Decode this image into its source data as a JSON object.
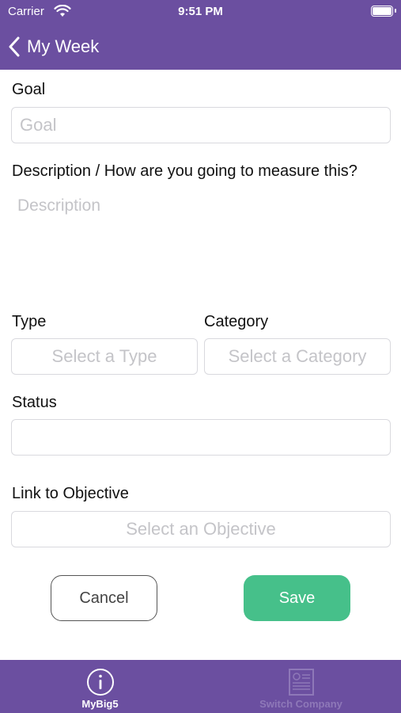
{
  "status_bar": {
    "carrier": "Carrier",
    "time": "9:51 PM"
  },
  "nav": {
    "back_label": "My Week"
  },
  "form": {
    "goal": {
      "label": "Goal",
      "placeholder": "Goal",
      "value": ""
    },
    "description": {
      "label": "Description / How are you going to measure this?",
      "placeholder": "Description",
      "value": ""
    },
    "type": {
      "label": "Type",
      "placeholder": "Select a Type"
    },
    "category": {
      "label": "Category",
      "placeholder": "Select a Category"
    },
    "status": {
      "label": "Status",
      "value": ""
    },
    "objective": {
      "label": "Link to Objective",
      "placeholder": "Select an Objective"
    }
  },
  "actions": {
    "cancel_label": "Cancel",
    "save_label": "Save"
  },
  "tab_bar": {
    "items": [
      {
        "label": "MyBig5",
        "icon": "info-circle-icon",
        "active": true
      },
      {
        "label": "Switch Company",
        "icon": "document-icon",
        "active": false
      }
    ]
  },
  "colors": {
    "brand": "#6b4fa0",
    "save": "#46c08a",
    "placeholder": "#c4c4c8",
    "tab_inactive": "#8e78b8"
  }
}
